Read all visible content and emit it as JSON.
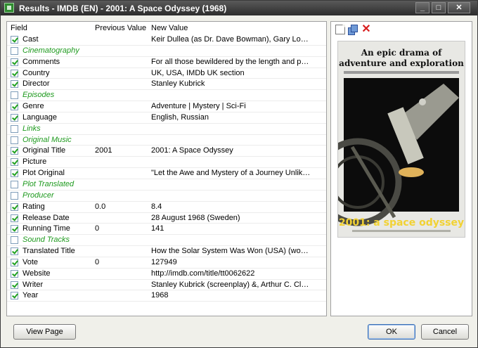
{
  "window": {
    "title": "Results - IMDB (EN) - 2001: A Space Odyssey (1968)"
  },
  "grid": {
    "headers": {
      "field": "Field",
      "previous": "Previous Value",
      "new": "New Value"
    },
    "rows": [
      {
        "field": "Cast",
        "checked": true,
        "previous": "",
        "new": "Keir Dullea (as Dr. Dave Bowman), Gary Lockw..."
      },
      {
        "field": "Cinematography",
        "checked": false,
        "previous": "",
        "new": ""
      },
      {
        "field": "Comments",
        "checked": true,
        "previous": "",
        "new": "For all those bewildered by the length and pac..."
      },
      {
        "field": "Country",
        "checked": true,
        "previous": "",
        "new": "UK, USA, IMDb UK section"
      },
      {
        "field": "Director",
        "checked": true,
        "previous": "",
        "new": "Stanley Kubrick"
      },
      {
        "field": "Episodes",
        "checked": false,
        "previous": "",
        "new": ""
      },
      {
        "field": "Genre",
        "checked": true,
        "previous": "",
        "new": "Adventure | Mystery | Sci-Fi"
      },
      {
        "field": "Language",
        "checked": true,
        "previous": "",
        "new": "English, Russian"
      },
      {
        "field": "Links",
        "checked": false,
        "previous": "",
        "new": ""
      },
      {
        "field": "Original Music",
        "checked": false,
        "previous": "",
        "new": ""
      },
      {
        "field": "Original Title",
        "checked": true,
        "previous": "2001",
        "new": "2001: A Space Odyssey"
      },
      {
        "field": "Picture",
        "checked": true,
        "previous": "",
        "new": ""
      },
      {
        "field": "Plot Original",
        "checked": true,
        "previous": "",
        "new": "\"Let the Awe and Mystery of a Journey Unlike ..."
      },
      {
        "field": "Plot Translated",
        "checked": false,
        "previous": "",
        "new": ""
      },
      {
        "field": "Producer",
        "checked": false,
        "previous": "",
        "new": ""
      },
      {
        "field": "Rating",
        "checked": true,
        "previous": "0.0",
        "new": "8.4"
      },
      {
        "field": "Release Date",
        "checked": true,
        "previous": "",
        "new": "28 August 1968 (Sweden)"
      },
      {
        "field": "Running Time",
        "checked": true,
        "previous": "0",
        "new": "141"
      },
      {
        "field": "Sound Tracks",
        "checked": false,
        "previous": "",
        "new": ""
      },
      {
        "field": "Translated Title",
        "checked": true,
        "previous": "",
        "new": "How the Solar System Was Won (USA) (workin..."
      },
      {
        "field": "Vote",
        "checked": true,
        "previous": "0",
        "new": "127949"
      },
      {
        "field": "Website",
        "checked": true,
        "previous": "",
        "new": "http://imdb.com/title/tt0062622"
      },
      {
        "field": "Writer",
        "checked": true,
        "previous": "",
        "new": "Stanley Kubrick (screenplay) &, Arthur C. Clark..."
      },
      {
        "field": "Year",
        "checked": true,
        "previous": "",
        "new": "1968"
      }
    ]
  },
  "poster": {
    "tagline": "An epic drama of adventure and exploration",
    "title": "2001: a space odyssey"
  },
  "buttons": {
    "view_page": "View Page",
    "ok": "OK",
    "cancel": "Cancel"
  },
  "colors": {
    "titlebar": "#3c3c3c",
    "unchecked_field": "#1e9a1e",
    "check": "#21a121",
    "delete_icon": "#d81e1e",
    "poster_title": "#f2d233"
  }
}
